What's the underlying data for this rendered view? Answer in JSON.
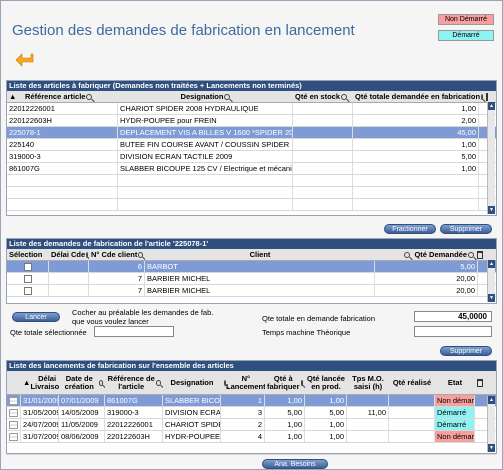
{
  "title": "Gestion des demandes de fabrication en lancement",
  "legend": {
    "not_started": "Non Démarré",
    "started": "Démarré"
  },
  "articles": {
    "header": "Liste des articles à fabriquer (Demandes non traitées + Lancements non terminés)",
    "columns": [
      "Référence article",
      "Designation",
      "Qté en stock",
      "Qté totale demandée en fabrication"
    ],
    "rows": [
      {
        "ref": "22012226001",
        "designation": "CHARIOT SPIDER 2008 HYDRAULIQUE",
        "stock": "",
        "total": "1,00"
      },
      {
        "ref": "220122603H",
        "designation": "HYDR-POUPEE pour FREIN",
        "stock": "",
        "total": "2,00"
      },
      {
        "ref": "225078-1",
        "designation": "DEPLACEMENT VIS A BILLES V 1600 *SPIDER 2008*",
        "stock": "",
        "total": "45,00"
      },
      {
        "ref": "225140",
        "designation": "BUTEE FIN COURSE AVANT / COUSSIN SPIDER",
        "stock": "",
        "total": "1,00"
      },
      {
        "ref": "319000-3",
        "designation": "DIVISION ECRAN TACTILE 2009",
        "stock": "",
        "total": "5,00"
      },
      {
        "ref": "861007G",
        "designation": "SLABBER BICOUPE 125 CV / Electrique et mécanique",
        "stock": "",
        "total": "1,00"
      }
    ]
  },
  "buttons": {
    "fractionner": "Fractionner",
    "supprimer": "Supprimer",
    "lancer": "Lancer",
    "supprimer2": "Supprimer",
    "ana_besoins": "Ana. Besoins"
  },
  "demands": {
    "header": "Liste des demandes de fabrication de l'article '225078-1'",
    "columns": [
      "Sélection",
      "Délai Cde",
      "N° Cde client",
      "Client",
      "Qté Demandée"
    ],
    "rows": [
      {
        "num": "6",
        "client": "BARBOT",
        "qty": "5,00"
      },
      {
        "num": "7",
        "client": "BARBIER MICHEL",
        "qty": "20,00"
      },
      {
        "num": "7",
        "client": "BARBIER MICHEL",
        "qty": "20,00"
      }
    ]
  },
  "launch_panel": {
    "hint": "Cocher au préalable les demandes de fab. que vous voulez lancer",
    "qty_selected_label": "Qte totale sélectionnée",
    "qty_total_label": "Qte totale en demande fabrication",
    "qty_total_value": "45,0000",
    "machine_time_label": "Temps machine Théorique"
  },
  "launches": {
    "header": "Liste des lancements de fabrication sur l'ensemble des articles",
    "columns": [
      "Délai Livraison",
      "Date de création",
      "Référence de l'article",
      "Designation",
      "N° Lancement",
      "Qté à fabriquer",
      "Qté lancée en prod.",
      "Tps M.O. saisi (h)",
      "Qté réalisé",
      "Etat"
    ],
    "rows": [
      {
        "delai": "31/01/2009",
        "created": "07/01/2009",
        "ref": "861007G",
        "designation": "SLABBER BICOI",
        "num": "1",
        "qty": "1,00",
        "launched": "1,00",
        "tps": "",
        "done": "",
        "state": "Non démarré",
        "status": "red",
        "selected": true
      },
      {
        "delai": "31/05/2009",
        "created": "14/05/2009",
        "ref": "319000-3",
        "designation": "DIVISION ECRAI",
        "num": "3",
        "qty": "5,00",
        "launched": "5,00",
        "tps": "11,00",
        "done": "",
        "state": "Démarré",
        "status": "cyan",
        "selected": false
      },
      {
        "delai": "24/07/2009",
        "created": "11/05/2009",
        "ref": "22012226001",
        "designation": "CHARIOT SPIDE",
        "num": "2",
        "qty": "1,00",
        "launched": "1,00",
        "tps": "",
        "done": "",
        "state": "Démarré",
        "status": "cyan",
        "selected": false
      },
      {
        "delai": "31/07/2009",
        "created": "08/06/2009",
        "ref": "220122603H",
        "designation": "HYDR-POUPEE |",
        "num": "4",
        "qty": "1,00",
        "launched": "1,00",
        "tps": "",
        "done": "",
        "state": "Non démarré",
        "status": "red",
        "selected": false
      }
    ]
  },
  "colors": {
    "header_bg": "#2f4f7f",
    "selected_row": "#7f9bd6",
    "not_started": "#f8a0a0",
    "started": "#8ff3f3"
  }
}
